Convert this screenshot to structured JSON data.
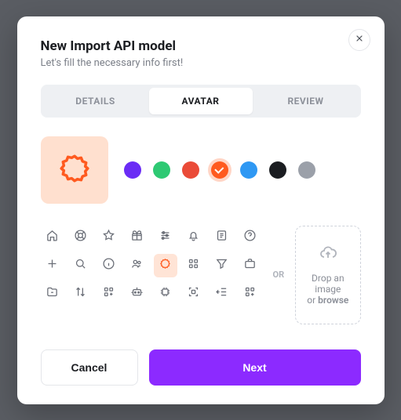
{
  "modal": {
    "title": "New Import API model",
    "subtitle": "Let's fill the necessary info first!"
  },
  "tabs": {
    "details": "DETAILS",
    "avatar": "AVATAR",
    "review": "REVIEW"
  },
  "colors": {
    "purple": "#6b2cf5",
    "green": "#2ec973",
    "red": "#ea4b38",
    "orange": "#ff5a1f",
    "blue": "#2f98f3",
    "black": "#1b1d21",
    "gray": "#9ba0a9"
  },
  "selected_color": "orange",
  "selected_icon": "cog-icon",
  "or_label": "OR",
  "dropzone": {
    "line1": "Drop an image",
    "line2_prefix": "or ",
    "line2_action": "browse"
  },
  "buttons": {
    "cancel": "Cancel",
    "next": "Next"
  }
}
